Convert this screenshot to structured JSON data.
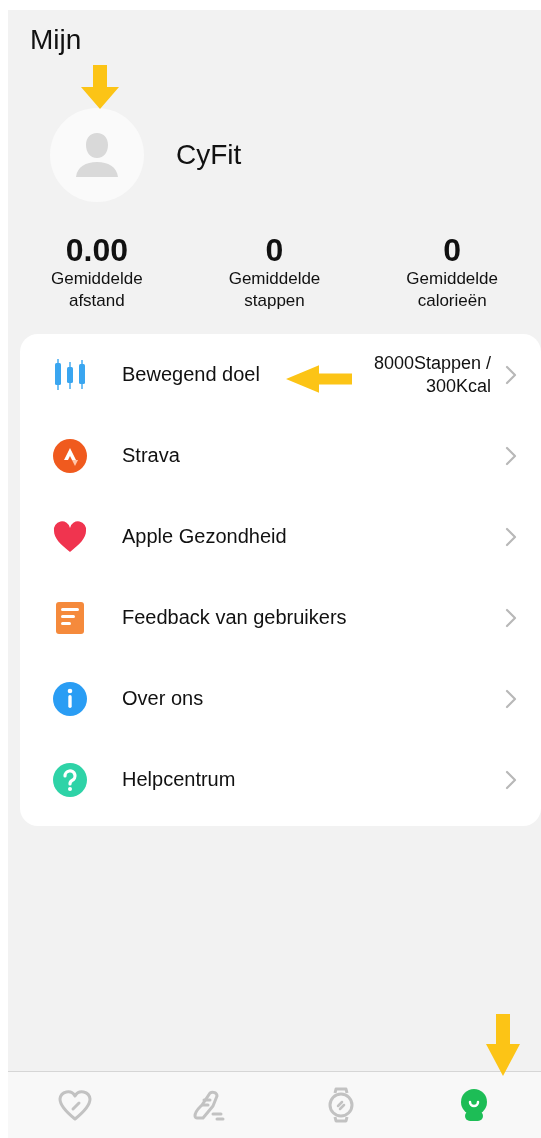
{
  "title": "Mijn",
  "profile": {
    "name": "CyFit"
  },
  "stats": [
    {
      "value": "0.00",
      "label": "Gemiddelde afstand"
    },
    {
      "value": "0",
      "label": "Gemiddelde stappen"
    },
    {
      "value": "0",
      "label": "Gemiddelde calorieën"
    }
  ],
  "menu": [
    {
      "kind": "goal",
      "label": "Bewegend doel",
      "value": "8000Stappen / 300Kcal"
    },
    {
      "kind": "strava",
      "label": "Strava"
    },
    {
      "kind": "health",
      "label": "Apple Gezondheid"
    },
    {
      "kind": "feedback",
      "label": "Feedback van gebruikers"
    },
    {
      "kind": "about",
      "label": "Over ons"
    },
    {
      "kind": "help",
      "label": "Helpcentrum"
    }
  ],
  "tabs": [
    {
      "kind": "health",
      "selected": false
    },
    {
      "kind": "activity",
      "selected": false
    },
    {
      "kind": "watch",
      "selected": false
    },
    {
      "kind": "profile",
      "selected": true
    }
  ]
}
